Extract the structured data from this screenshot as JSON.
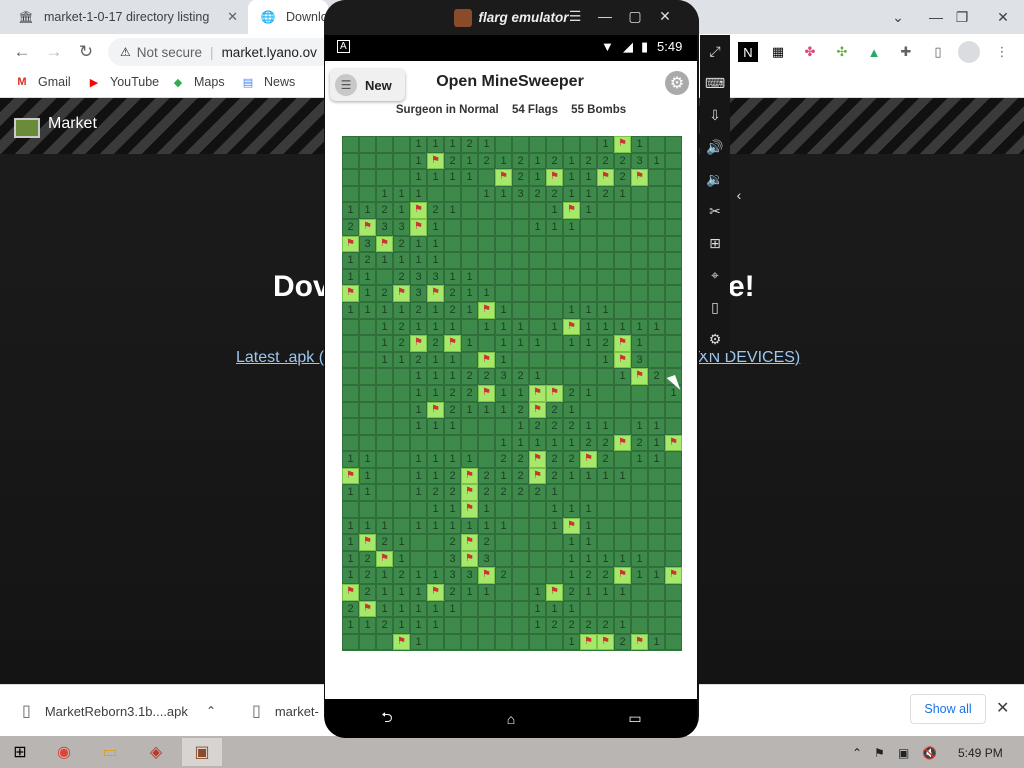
{
  "browser": {
    "tabs": [
      {
        "label": "market-1-0-17 directory listing",
        "icon": "museum-icon"
      },
      {
        "label": "Downlo",
        "icon": "globe-icon"
      }
    ],
    "address": {
      "security": "Not secure",
      "url": "market.lyano.ov"
    },
    "bookmarks": [
      {
        "label": "Gmail",
        "icon": "gmail-icon",
        "color": "#d93025"
      },
      {
        "label": "YouTube",
        "icon": "youtube-icon",
        "color": "#ff0000"
      },
      {
        "label": "Maps",
        "icon": "maps-icon",
        "color": "#34a853"
      },
      {
        "label": "News",
        "icon": "news-icon",
        "color": "#4285f4"
      }
    ]
  },
  "page": {
    "site_title": "Market",
    "hero_left": "Dov",
    "hero_right": "e!",
    "link_left": "Latest .apk (",
    "link_right": "XN DEVICES)"
  },
  "downloads": {
    "items": [
      {
        "label": "MarketReborn3.1b....apk"
      },
      {
        "label": "market-"
      }
    ],
    "show_all": "Show all"
  },
  "taskbar": {
    "time": "5:49 PM"
  },
  "emulator": {
    "title": "flarg emulator",
    "status": {
      "time": "5:49"
    },
    "game": {
      "new_label": "New",
      "title": "Open MineSweeper",
      "player": "Surgeon in Normal",
      "flags": "54 Flags",
      "bombs": "55 Bombs",
      "board": [
        "0000111210000001F1",
        "00001F2121212122231",
        "000011110F21F11F2F",
        "00111000113221121",
        "1121F21000001F1",
        "2F33F1000001110",
        "F3F211",
        "121111",
        "11023311",
        "F12F3F211",
        "11112121F1000111",
        "0012111011101F11111",
        "0012F2F101110112F1",
        "00112110F1000001F3",
        "00001112232100001F2",
        "00001122F11FF2100001",
        "00001F21112F21",
        "0000111000122211011",
        "0000000001111122F21F",
        "11001111022F22F2011",
        "F100112F212F21111",
        "1100122F22221",
        "0000011F1000111",
        "1110111111001F1",
        "1F21002F2000011",
        "12F1003F3000011111",
        "12121133F2000122F11F",
        "F2111F211001F2111",
        "2F111110000111",
        "11211100000122221",
        "000F1000000001FF2F1"
      ]
    }
  }
}
